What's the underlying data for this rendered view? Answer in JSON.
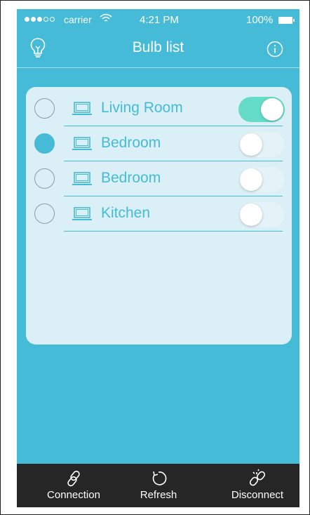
{
  "status_bar": {
    "carrier": "carrier",
    "time": "4:21 PM",
    "battery": "100%",
    "signal_bars_filled": 3,
    "signal_bars_total": 5
  },
  "nav": {
    "title": "Bulb list",
    "left_icon": "bulb-icon",
    "right_icon": "info-icon"
  },
  "bulbs": [
    {
      "name": "Living Room",
      "selected": false,
      "on": true
    },
    {
      "name": "Bedroom",
      "selected": true,
      "on": false
    },
    {
      "name": "Bedroom",
      "selected": false,
      "on": false
    },
    {
      "name": "Kitchen",
      "selected": false,
      "on": false
    }
  ],
  "tabs": [
    {
      "label": "Connection",
      "icon": "link-icon"
    },
    {
      "label": "Refresh",
      "icon": "refresh-icon"
    },
    {
      "label": "Disconnect",
      "icon": "broken-link-icon"
    }
  ],
  "colors": {
    "background": "#45bbd7",
    "card": "#daf0f6",
    "toggle_on": "#64dcc8",
    "tab_bar": "#262626"
  }
}
